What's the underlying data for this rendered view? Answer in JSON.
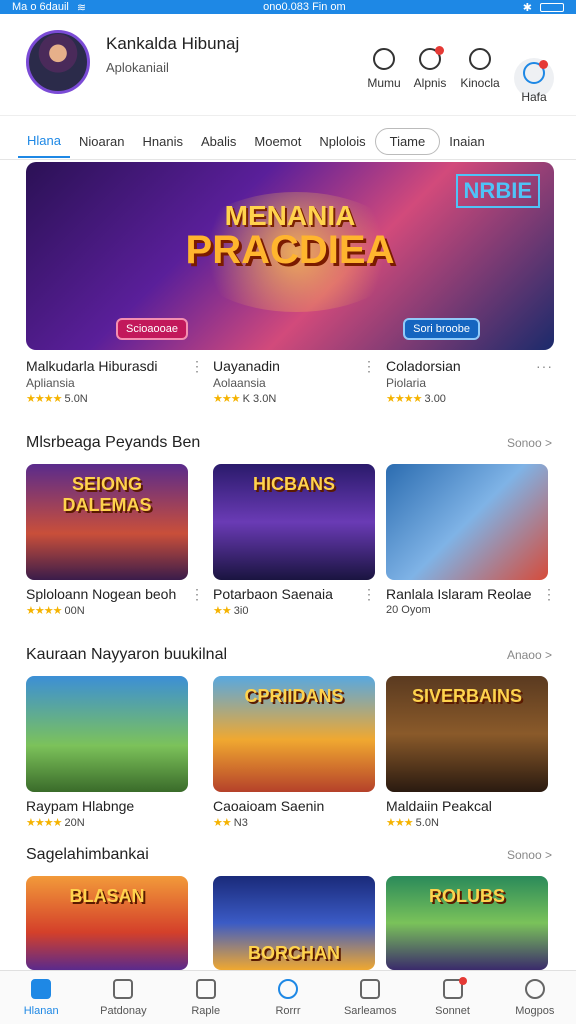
{
  "status_bar": {
    "left": "Ma o 6dauil",
    "center": "ono0.083 Fin om"
  },
  "header": {
    "title": "Kankalda Hibunaj",
    "subtitle": "Aplokaniail",
    "actions": [
      {
        "label": "Mumu",
        "icon": "music-icon"
      },
      {
        "label": "Alpnis",
        "icon": "trophy-icon"
      },
      {
        "label": "Kinocla",
        "icon": "group-icon"
      },
      {
        "label": "Hafa",
        "icon": "chat-icon"
      }
    ]
  },
  "tabs": [
    "Hlana",
    "Nioaran",
    "Hnanis",
    "Abalis",
    "Moemot",
    "Nplolois",
    "Tiame",
    "Inaian"
  ],
  "hero": {
    "title_top": "MENANIA",
    "title_main": "PRACDIEA",
    "sign": "NRBIE",
    "badge_left": "Scioaooae",
    "badge_right": "Sori broobe"
  },
  "featured": [
    {
      "title": "Malkudarla Hiburasdi",
      "subtitle": "Apliansia",
      "stars": "★★★★",
      "rating": "5.0N"
    },
    {
      "title": "Uayanadin",
      "subtitle": "Aolaansia",
      "stars": "★★★",
      "rating": "K 3.0N"
    },
    {
      "title": "Coladorsian",
      "subtitle": "Piolaria",
      "stars": "★★★★",
      "rating": "3.00"
    }
  ],
  "sections": [
    {
      "title": "Mlsrbeaga Peyands Ben",
      "more": "Sonoo >",
      "items": [
        {
          "thumb_label": "SEIONG DALEMAS",
          "title": "Sploloann Nogean beoh",
          "stars": "★★★★",
          "rating": "00N"
        },
        {
          "thumb_label": "HICBANS",
          "title": "Potarbaon Saenaia",
          "stars": "★★",
          "rating": "3i0"
        },
        {
          "thumb_label": "",
          "title": "Ranlala Islaram Reolae",
          "stars": "",
          "rating": "20 Oyom"
        }
      ]
    },
    {
      "title": "Kauraan Nayyaron buukilnal",
      "more": "Anaoo >",
      "items": [
        {
          "thumb_label": "",
          "title": "Raypam Hlabnge",
          "stars": "★★★★",
          "rating": "20N"
        },
        {
          "thumb_label": "CPRIIDANS",
          "title": "Caoaioam Saenin",
          "stars": "★★",
          "rating": "N3"
        },
        {
          "thumb_label": "SIVERBAINS",
          "title": "Maldaiin Peakcal",
          "stars": "★★★",
          "rating": "5.0N"
        }
      ]
    },
    {
      "title": "Sagelahimbankai",
      "more": "Sonoo >",
      "items": [
        {
          "thumb_label": "BLASAN",
          "title": "",
          "stars": "",
          "rating": ""
        },
        {
          "thumb_label": "BORCHAN",
          "title": "",
          "stars": "",
          "rating": ""
        },
        {
          "thumb_label": "ROLUBS",
          "title": "",
          "stars": "",
          "rating": ""
        }
      ]
    }
  ],
  "bottom_nav": [
    {
      "label": "Hlanan",
      "icon": "home-icon"
    },
    {
      "label": "Patdonay",
      "icon": "calendar-icon"
    },
    {
      "label": "Raple",
      "icon": "book-icon"
    },
    {
      "label": "Rorrr",
      "icon": "refresh-icon"
    },
    {
      "label": "Sarleamos",
      "icon": "folder-icon"
    },
    {
      "label": "Sonnet",
      "icon": "bell-icon"
    },
    {
      "label": "Mogpos",
      "icon": "user-icon"
    }
  ],
  "colors": {
    "accent": "#1e88e5",
    "badge": "#e53935",
    "star": "#f5b301"
  }
}
